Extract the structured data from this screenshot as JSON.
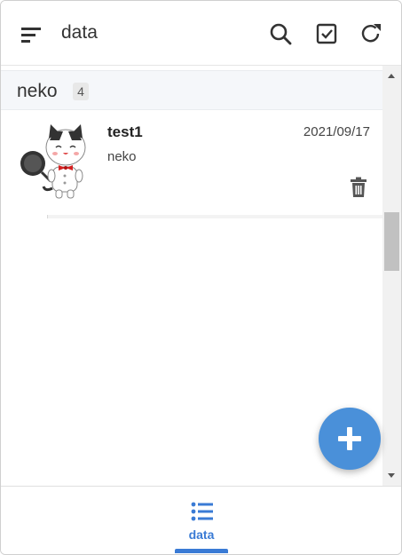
{
  "header": {
    "title": "data",
    "actions": [
      {
        "icon": "search-icon"
      },
      {
        "icon": "checkbox-icon"
      },
      {
        "icon": "refresh-icon"
      }
    ]
  },
  "groups": [
    {
      "name": "neko",
      "count": "4",
      "items": [
        {
          "title": "test1",
          "date": "2021/09/17",
          "subtitle": "neko",
          "image": "cat-chef-avatar"
        }
      ]
    }
  ],
  "fab": {
    "icon": "plus-icon"
  },
  "bottom_nav": {
    "items": [
      {
        "label": "data",
        "icon": "list-icon",
        "active": true
      }
    ]
  },
  "colors": {
    "accent": "#3a7bd5",
    "fab": "#4a90d9",
    "group_header_bg": "#f5f7fa"
  }
}
